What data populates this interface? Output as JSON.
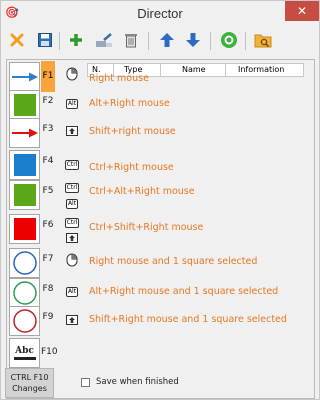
{
  "window": {
    "title": "Director",
    "close_glyph": "✕",
    "app_icon": "🎯"
  },
  "toolbar": {
    "icons": [
      "cross-icon",
      "save-icon",
      "plus-icon",
      "tools-icon",
      "trash-icon",
      "arrow-up-icon",
      "arrow-down-icon",
      "green-circle-icon",
      "folder-search-icon"
    ]
  },
  "table": {
    "columns": [
      "N.",
      "Type",
      "Name",
      "Information"
    ]
  },
  "slots": [
    {
      "key": "F1",
      "swatch": "blue-arrow",
      "modifiers": [
        "mouse-right"
      ],
      "description": "Right mouse"
    },
    {
      "key": "F2",
      "swatch": "green-square",
      "modifiers": [
        "Alt"
      ],
      "description": "Alt+Right mouse"
    },
    {
      "key": "F3",
      "swatch": "red-arrow",
      "modifiers": [
        "Shift"
      ],
      "description": "Shift+right mouse"
    },
    {
      "key": "F4",
      "swatch": "blue-square",
      "modifiers": [
        "Ctrl"
      ],
      "description": "Ctrl+Right mouse"
    },
    {
      "key": "F5",
      "swatch": "green-square",
      "modifiers": [
        "Ctrl",
        "Alt"
      ],
      "description": "Ctrl+Alt+Right mouse"
    },
    {
      "key": "F6",
      "swatch": "red-square",
      "modifiers": [
        "Ctrl",
        "Shift"
      ],
      "description": "Ctrl+Shift+Right mouse"
    },
    {
      "key": "F7",
      "swatch": "blue-circle",
      "modifiers": [
        "mouse-right"
      ],
      "description": "Right mouse and 1 square selected"
    },
    {
      "key": "F8",
      "swatch": "green-circle",
      "modifiers": [
        "Alt"
      ],
      "description": "Alt+Right mouse and 1 square selected"
    },
    {
      "key": "F9",
      "swatch": "red-circle",
      "modifiers": [
        "Shift"
      ],
      "description": "Shift+Right mouse and 1 square selected"
    },
    {
      "key": "F10",
      "swatch": "abc-text",
      "modifiers": [],
      "description": ""
    }
  ],
  "swatch_text": "Abc",
  "footer": {
    "changes_line1": "CTRL F10",
    "changes_line2": "Changes",
    "save_label": "Save when finished"
  },
  "colors": {
    "accent": "#f7a43a",
    "description": "#e87722",
    "blue": "#2b7fd0",
    "green": "#5aa81a",
    "red": "#e01010"
  }
}
